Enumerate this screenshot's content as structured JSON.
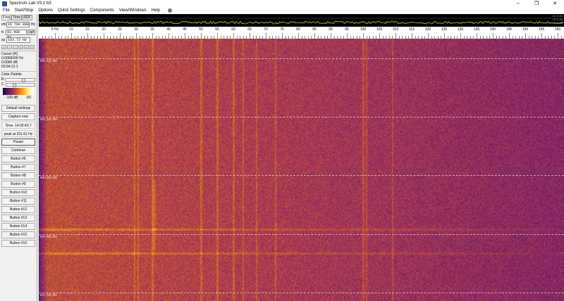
{
  "window": {
    "title": "Spectrum Lab V3.1 b3",
    "minimize": "–",
    "maximize": "❐",
    "close": "✕"
  },
  "menu": [
    "File",
    "Start/Stop",
    "Options",
    "Quick Settings",
    "Components",
    "View/Windows",
    "Help"
  ],
  "tabs": [
    "Freq",
    "Time",
    "RDF"
  ],
  "fields": {
    "vfo_label": "vfo",
    "vfo_value": "10 700 000",
    "vfo_unit": "Hz",
    "fc_label": "fc",
    "fc_value": "81.408 Hz",
    "fc_opt": "opt",
    "sp_label": "sp",
    "sp_value": "163.73 Hz"
  },
  "arrows": [
    "«",
    "‹",
    "›",
    "»",
    "«",
    "»"
  ],
  "cursor": {
    "title": "Cursor [H]",
    "freq": "0.0000000 Hz",
    "level": "0.0000 dB",
    "time": "03:54:12.1"
  },
  "palette": {
    "title": "Color Palette",
    "b": "B",
    "c": "C",
    "b_value": 0.7,
    "c_value": 0.3,
    "min": "-100 dB",
    "max": "-50"
  },
  "buttons": {
    "default": "Default settings",
    "capture": "Capture now",
    "time": "Time:  14:05:43.7",
    "peak": "peak at 201.61 Hz",
    "pause": "Pause",
    "continue": "Continue",
    "numbered": [
      "Button #6",
      "Button #7",
      "Button #8",
      "Button #9",
      "Button #10",
      "Button #11",
      "Button #12",
      "Button #13",
      "Button #14",
      "Button #15",
      "Button #16"
    ]
  },
  "spectrum": {
    "db_labels": [
      "-50.0 dB",
      "-60.0 dB",
      "-70.0 dB"
    ],
    "trace_color": "#c8c020"
  },
  "freq_axis": {
    "labels": [
      "5 Hz",
      "10",
      "15",
      "20",
      "25",
      "30",
      "35",
      "40",
      "45",
      "50",
      "55",
      "60",
      "65",
      "70",
      "75",
      "80",
      "85",
      "90",
      "95",
      "100",
      "105",
      "110",
      "115",
      "120",
      "125",
      "130",
      "135",
      "140",
      "145",
      "150",
      "155",
      "160"
    ],
    "values": [
      5,
      10,
      15,
      20,
      25,
      30,
      35,
      40,
      45,
      50,
      55,
      60,
      65,
      70,
      75,
      80,
      85,
      90,
      95,
      100,
      105,
      110,
      115,
      120,
      125,
      130,
      135,
      140,
      145,
      150,
      155,
      160
    ]
  },
  "time_axis": {
    "labels": [
      "04:15:00",
      "04:10:00",
      "04:05:00",
      "04:00:01",
      "03:55:01"
    ]
  }
}
